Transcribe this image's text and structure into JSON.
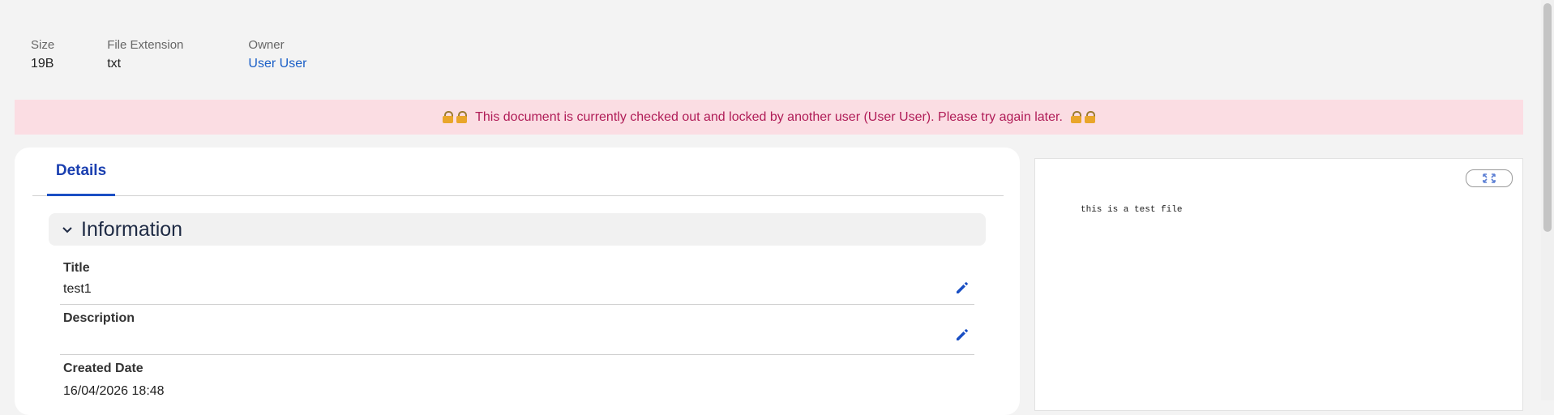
{
  "meta": {
    "size": {
      "label": "Size",
      "value": "19B"
    },
    "extension": {
      "label": "File Extension",
      "value": "txt"
    },
    "owner": {
      "label": "Owner",
      "value": "User User"
    }
  },
  "banner": {
    "text": "This document is currently checked out and locked by another user (User User). Please try again later.",
    "color": "#b01c57",
    "background": "#fbdde3"
  },
  "tabs": {
    "details": "Details"
  },
  "section": {
    "title": "Information"
  },
  "fields": {
    "title": {
      "label": "Title",
      "value": "test1"
    },
    "description": {
      "label": "Description",
      "value": ""
    },
    "created": {
      "label": "Created Date",
      "value": "16/04/2026 18:48"
    }
  },
  "preview": {
    "text": "this is a test file"
  },
  "icons": {
    "lock": "lock-icon",
    "edit": "pencil-icon",
    "chevron": "chevron-down-icon",
    "fullscreen": "expand-icon"
  },
  "colors": {
    "accent": "#1a4fc4",
    "link": "#1a5fc7"
  }
}
